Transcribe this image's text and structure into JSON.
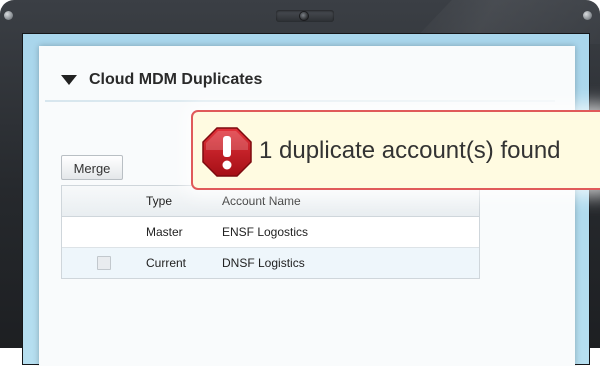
{
  "header": {
    "title": "Cloud MDM Duplicates"
  },
  "toolbar": {
    "merge_label": "Merge"
  },
  "table": {
    "columns": [
      "",
      "Type",
      "Account Name"
    ],
    "rows": [
      {
        "type": "Master",
        "account_name": "ENSF Logostics",
        "has_checkbox": false
      },
      {
        "type": "Current",
        "account_name": "DNSF Logistics",
        "has_checkbox": true
      }
    ]
  },
  "alert": {
    "icon": "exclamation-icon",
    "message": "1 duplicate account(s) found"
  },
  "colors": {
    "screen_bg": "#a9d6ec",
    "alert_border": "#e05a5a",
    "alert_bg": "#fffbe1",
    "badge_red": "#c9161d"
  }
}
